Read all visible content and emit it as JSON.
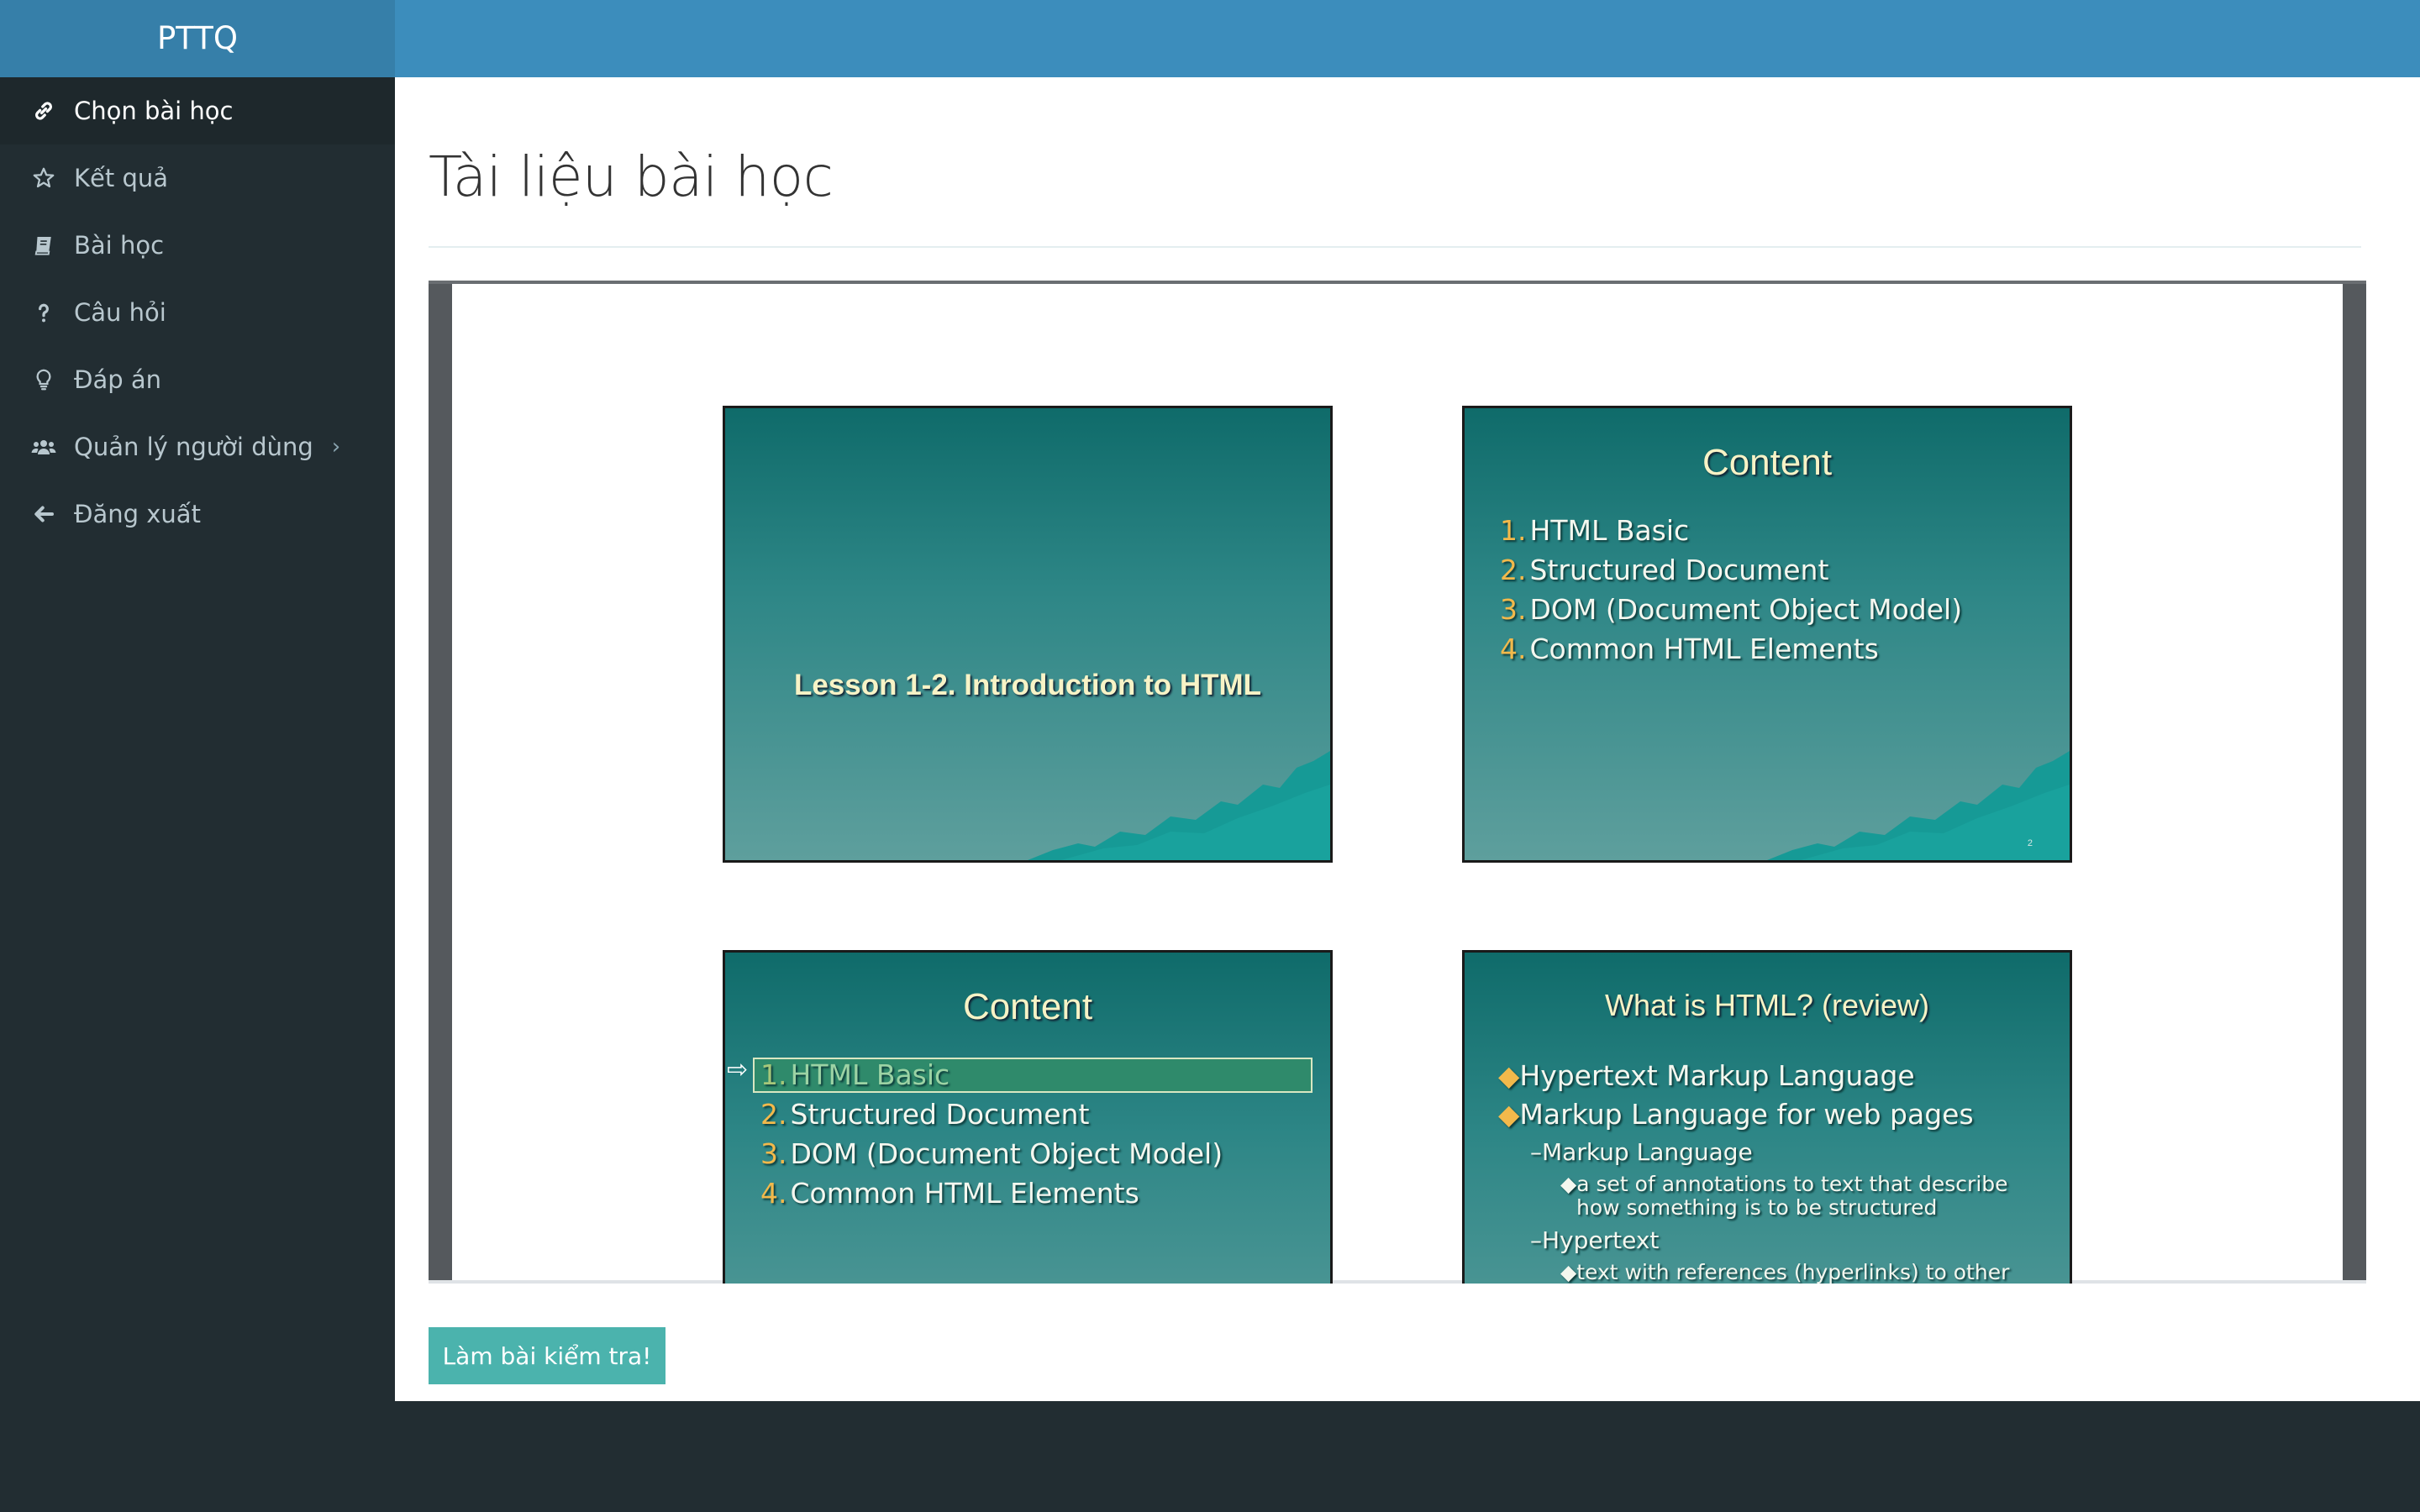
{
  "brand": "PTTQ",
  "sidebar": {
    "items": [
      {
        "label": "Chọn bài học",
        "icon": "link-icon"
      },
      {
        "label": "Kết quả",
        "icon": "star-icon"
      },
      {
        "label": "Bài học",
        "icon": "book-icon"
      },
      {
        "label": "Câu hỏi",
        "icon": "question-icon"
      },
      {
        "label": "Đáp án",
        "icon": "lightbulb-icon"
      },
      {
        "label": "Quản lý người dùng",
        "icon": "users-icon"
      },
      {
        "label": "Đăng xuất",
        "icon": "arrow-left-icon"
      }
    ],
    "chevron": "›"
  },
  "page": {
    "title": "Tài liệu bài học",
    "button_label": "Làm bài kiểm tra!"
  },
  "slides": {
    "s1": {
      "title": "Lesson 1-2. Introduction to HTML"
    },
    "s2": {
      "title": "Content",
      "page_number": "2",
      "items": [
        {
          "n": "1.",
          "text": "HTML Basic"
        },
        {
          "n": "2.",
          "text": "Structured Document"
        },
        {
          "n": "3.",
          "text": "DOM (Document Object Model)"
        },
        {
          "n": "4.",
          "text": "Common HTML Elements"
        }
      ]
    },
    "s3": {
      "title": "Content",
      "items": [
        {
          "n": "1.",
          "text": "HTML Basic"
        },
        {
          "n": "2.",
          "text": "Structured Document"
        },
        {
          "n": "3.",
          "text": "DOM (Document Object Model)"
        },
        {
          "n": "4.",
          "text": "Common HTML Elements"
        }
      ]
    },
    "s4": {
      "title": "What is HTML? (review)",
      "b1": "Hypertext Markup Language",
      "b2": "Markup Language for web pages",
      "b3": "Markup Language",
      "b4a": "a set of annotations to text that describe",
      "b4b": "how something is to be structured",
      "b5": "Hypertext",
      "b6": "text with references (hyperlinks) to other"
    }
  },
  "colors": {
    "topbar": "#3c8dbc",
    "brand_bg": "#367fa9",
    "sidebar": "#222d32",
    "button": "#4bb3ad",
    "slide_accent": "#f2b94b"
  }
}
